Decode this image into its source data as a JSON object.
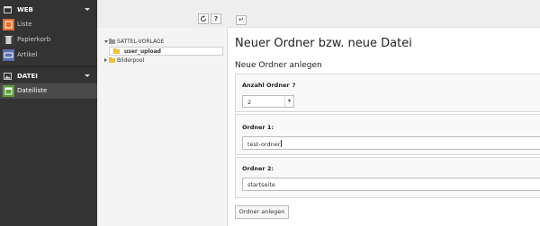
{
  "module_menu": {
    "groups": [
      {
        "label": "WEB",
        "icon": "globe-icon",
        "items": [
          {
            "label": "Liste",
            "icon": "list-module-icon",
            "color": "#e07030"
          },
          {
            "label": "Papierkorb",
            "icon": "recycler-module-icon",
            "color": "#cfcfcf"
          },
          {
            "label": "Artikel",
            "icon": "article-module-icon",
            "color": "#5a6fb0"
          }
        ]
      },
      {
        "label": "DATEI",
        "icon": "image-icon",
        "items": [
          {
            "label": "Dateiliste",
            "icon": "filelist-module-icon",
            "color": "#5b9d3a",
            "active": true
          }
        ]
      }
    ]
  },
  "tree": {
    "toolbar": {
      "refresh_icon": "refresh-icon",
      "help_label": "?"
    },
    "nodes": [
      {
        "label": "SATTEL-VORLAGE",
        "expanded": true,
        "icon": "folder-icon"
      },
      {
        "label": "user_upload",
        "selected": true,
        "icon": "folder-icon"
      },
      {
        "label": "Bilderpool",
        "expanded": false,
        "icon": "folder-icon"
      }
    ]
  },
  "content": {
    "toolbar": {
      "back_label": "↵"
    },
    "title": "Neuer Ordner bzw. neue Datei",
    "section_title": "Neue Ordner anlegen",
    "count_field": {
      "label": "Anzahl Ordner",
      "help": "?",
      "value": "2"
    },
    "folders": [
      {
        "label": "Ordner 1:",
        "value": "test-ordner"
      },
      {
        "label": "Ordner 2:",
        "value": "startseite"
      }
    ],
    "submit_label": "Ordner anlegen"
  },
  "colors": {
    "sidebar_bg": "#333333",
    "active_item_bg": "#4a4a4a",
    "panel_bg": "#eeeeee"
  }
}
